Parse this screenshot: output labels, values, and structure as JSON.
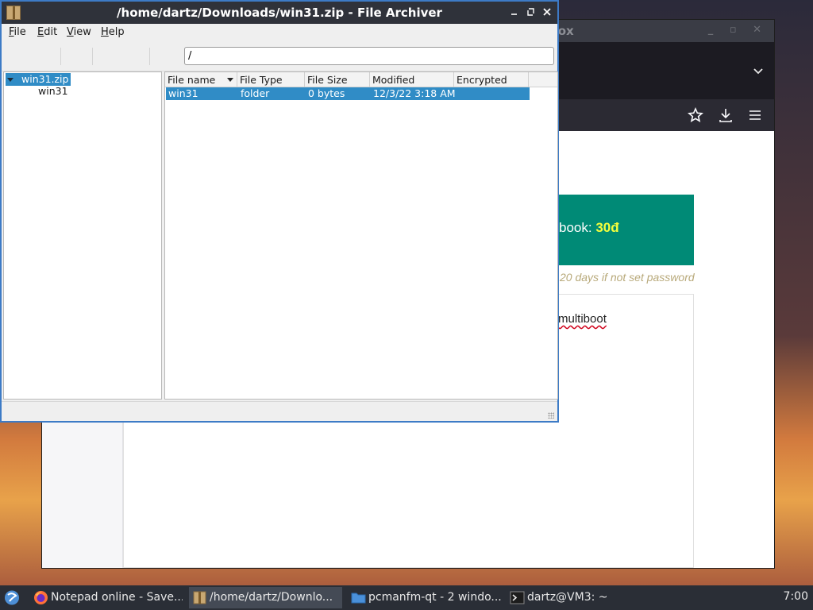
{
  "firefox": {
    "title_fragment": "efox",
    "banner_prefix": "book: ",
    "banner_value": "30đ",
    "note": "20 days if not set password",
    "card_text": "multiboot"
  },
  "archiver": {
    "title": "/home/dartz/Downloads/win31.zip - File Archiver",
    "menu": {
      "file": {
        "ul": "F",
        "rest": "ile"
      },
      "edit": {
        "ul": "E",
        "rest": "dit"
      },
      "view": {
        "ul": "V",
        "rest": "iew"
      },
      "help": {
        "ul": "H",
        "rest": "elp"
      }
    },
    "path_value": "/",
    "tree": {
      "root": "win31.zip",
      "child": "win31"
    },
    "columns": [
      "File name",
      "File Type",
      "File Size",
      "Modified",
      "Encrypted"
    ],
    "rows": [
      {
        "name": "win31",
        "type": "folder",
        "size": "0 bytes",
        "modified": "12/3/22 3:18 AM",
        "encrypted": ""
      }
    ]
  },
  "taskbar": {
    "items": [
      {
        "label": "Notepad online - Save...",
        "icon": "firefox-icon"
      },
      {
        "label": "/home/dartz/Downlo...",
        "icon": "archive-icon"
      },
      {
        "label": "pcmanfm-qt - 2 windo...",
        "icon": "folder-icon"
      },
      {
        "label": "dartz@VM3: ~",
        "icon": "terminal-icon"
      }
    ],
    "clock": "7:00"
  },
  "colors": {
    "selection": "#308cc6",
    "window_border": "#3d7bc6",
    "banner": "#008a76",
    "banner_value": "#f4ff3c"
  }
}
